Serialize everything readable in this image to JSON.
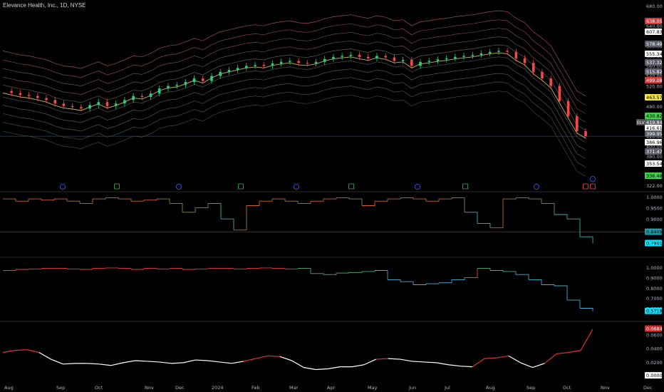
{
  "header": {
    "title": "Elevance Health, Inc., 1D, NYSE"
  },
  "colors": {
    "bg": "#000000",
    "up": "#26a69a",
    "down": "#ef5350",
    "white": "#ffffff",
    "red_line": "#f23645",
    "cyan": "#00e5ff",
    "lime": "#66ff66",
    "yellow": "#f5e642",
    "band_top": "#b85c5c",
    "band_mid": "#8a8a8a",
    "separator": "#2a2a2a",
    "marker_blue": "#3d5afe",
    "marker_green": "#3fb950"
  },
  "chart_data": [
    {
      "type": "candlestick",
      "title": "Elevance Health, Inc., 1D, NYSE",
      "ticker_label": "ELV",
      "x_labels": [
        "Aug",
        "Sep",
        "Oct",
        "Nov",
        "Dec",
        "2024",
        "Feb",
        "Mar",
        "Apr",
        "May",
        "Jun",
        "Jul",
        "Aug",
        "Sep",
        "Oct",
        "Nov",
        "Dec"
      ],
      "y_ticks": [
        680.0,
        640.0,
        600.0,
        580.0,
        560.0,
        540.0,
        520.0,
        500.0,
        480.0,
        460.0,
        440.0,
        420.0,
        400.0,
        380.0,
        364.0,
        340.0,
        322.0
      ],
      "ylim": [
        322,
        680
      ],
      "price_badges": [
        {
          "value": "638.05",
          "style": "red"
        },
        {
          "value": "607.83",
          "style": "white"
        },
        {
          "value": "578.49",
          "style": "gray"
        },
        {
          "value": "555.34",
          "style": "white"
        },
        {
          "value": "537.32",
          "style": "gray"
        },
        {
          "value": "515.82",
          "style": "gray"
        },
        {
          "value": "499.08",
          "style": "red"
        },
        {
          "value": "463.57",
          "style": "yellow"
        },
        {
          "value": "430.82",
          "style": "green"
        },
        {
          "value": "419.84",
          "style": "gray"
        },
        {
          "value": "416.61",
          "style": "white"
        },
        {
          "value": "399.95",
          "style": "gray"
        },
        {
          "value": "386.96",
          "style": "white"
        },
        {
          "value": "371.47",
          "style": "gray"
        },
        {
          "value": "353.54",
          "style": "white"
        },
        {
          "value": "336.48",
          "style": "green"
        }
      ],
      "close_path": [
        [
          0,
          510
        ],
        [
          6,
          506
        ],
        [
          12,
          502
        ],
        [
          18,
          500
        ],
        [
          24,
          496
        ],
        [
          30,
          492
        ],
        [
          36,
          485
        ],
        [
          42,
          480
        ],
        [
          48,
          478
        ],
        [
          54,
          475
        ],
        [
          60,
          482
        ],
        [
          66,
          488
        ],
        [
          72,
          480
        ],
        [
          78,
          485
        ],
        [
          84,
          492
        ],
        [
          90,
          500
        ],
        [
          96,
          498
        ],
        [
          102,
          505
        ],
        [
          108,
          515
        ],
        [
          114,
          520
        ],
        [
          120,
          522
        ],
        [
          126,
          528
        ],
        [
          132,
          535
        ],
        [
          138,
          530
        ],
        [
          144,
          540
        ],
        [
          150,
          548
        ],
        [
          156,
          552
        ],
        [
          162,
          556
        ],
        [
          168,
          560
        ],
        [
          174,
          562
        ],
        [
          180,
          560
        ],
        [
          186,
          565
        ],
        [
          192,
          568
        ],
        [
          198,
          570
        ],
        [
          204,
          566
        ],
        [
          210,
          565
        ],
        [
          216,
          568
        ],
        [
          222,
          574
        ],
        [
          228,
          578
        ],
        [
          234,
          580
        ],
        [
          240,
          582
        ],
        [
          246,
          578
        ],
        [
          252,
          575
        ],
        [
          258,
          580
        ],
        [
          264,
          577
        ],
        [
          270,
          570
        ],
        [
          276,
          572
        ],
        [
          282,
          560
        ],
        [
          288,
          568
        ],
        [
          294,
          570
        ],
        [
          300,
          573
        ],
        [
          306,
          575
        ],
        [
          312,
          578
        ],
        [
          318,
          580
        ],
        [
          324,
          582
        ],
        [
          330,
          585
        ],
        [
          336,
          588
        ],
        [
          342,
          590
        ],
        [
          348,
          588
        ],
        [
          354,
          575
        ],
        [
          360,
          566
        ],
        [
          364,
          548
        ],
        [
          368,
          535
        ],
        [
          372,
          520
        ],
        [
          376,
          490
        ],
        [
          380,
          460
        ],
        [
          384,
          430
        ],
        [
          386,
          420
        ]
      ],
      "band_offsets": [
        80,
        62,
        45,
        28,
        12,
        -12,
        -28,
        -45,
        -62,
        -80
      ]
    },
    {
      "type": "line",
      "y_ticks": [
        "1.0000",
        "0.9500",
        "0.9000",
        "0.8500",
        "0.8000"
      ],
      "ylim": [
        0.75,
        1.0
      ],
      "last_value": "0.8409",
      "min_badge": "0.7901",
      "values": [
        0.99,
        0.98,
        0.99,
        0.985,
        0.99,
        0.98,
        0.97,
        0.99,
        0.995,
        0.99,
        0.98,
        0.985,
        0.99,
        0.97,
        0.93,
        0.95,
        0.97,
        0.9,
        0.85,
        0.96,
        0.98,
        0.99,
        0.98,
        0.97,
        0.98,
        0.99,
        0.995,
        0.99,
        0.96,
        0.98,
        0.99,
        0.995,
        0.99,
        0.98,
        0.99,
        0.995,
        0.93,
        0.88,
        0.86,
        0.99,
        0.995,
        0.99,
        0.97,
        0.92,
        0.9,
        0.82,
        0.79
      ]
    },
    {
      "type": "line",
      "y_ticks": [
        "1.0000",
        "0.9000",
        "0.8000",
        "0.7000",
        "0.6000"
      ],
      "ylim": [
        0.52,
        1.05
      ],
      "last_value": "0.5718",
      "values": [
        0.97,
        0.98,
        0.985,
        0.99,
        0.99,
        0.985,
        0.98,
        0.99,
        0.995,
        0.99,
        0.98,
        0.99,
        0.985,
        0.99,
        0.98,
        0.985,
        0.99,
        0.99,
        0.985,
        0.99,
        0.995,
        0.99,
        0.985,
        0.99,
        0.94,
        0.93,
        0.945,
        0.95,
        0.96,
        0.97,
        0.88,
        0.86,
        0.83,
        0.84,
        0.85,
        0.88,
        0.9,
        0.99,
        0.97,
        0.96,
        0.93,
        0.88,
        0.83,
        0.82,
        0.68,
        0.6,
        0.57
      ]
    },
    {
      "type": "line",
      "y_ticks": [
        "0.0600",
        "0.0400",
        "0.0200",
        "0.0000"
      ],
      "ylim": [
        -0.003,
        0.072
      ],
      "last_value": "0.0684",
      "zero_badge": "0.0000",
      "values": [
        0.034,
        0.037,
        0.038,
        0.034,
        0.024,
        0.017,
        0.018,
        0.018,
        0.017,
        0.015,
        0.019,
        0.022,
        0.021,
        0.02,
        0.018,
        0.019,
        0.023,
        0.022,
        0.02,
        0.018,
        0.021,
        0.025,
        0.029,
        0.028,
        0.022,
        0.012,
        0.009,
        0.01,
        0.013,
        0.013,
        0.016,
        0.024,
        0.025,
        0.024,
        0.021,
        0.02,
        0.019,
        0.016,
        0.014,
        0.013,
        0.025,
        0.026,
        0.029,
        0.019,
        0.012,
        0.018,
        0.032,
        0.034,
        0.037,
        0.068
      ]
    }
  ]
}
